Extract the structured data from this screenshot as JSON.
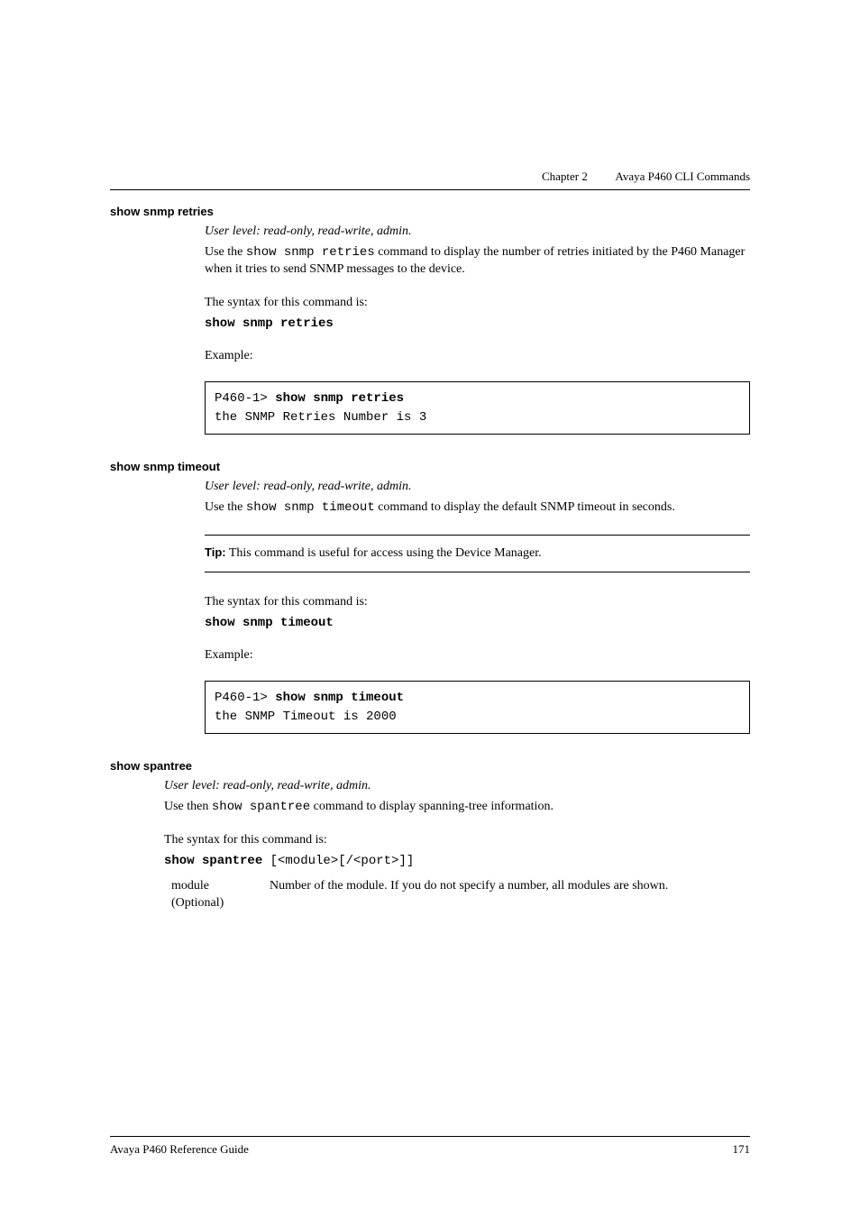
{
  "header": {
    "chapter": "Chapter 2",
    "title": "Avaya P460 CLI Commands"
  },
  "sections": {
    "retries": {
      "heading": "show snmp retries",
      "user_level": "User level: read-only, read-write, admin.",
      "desc_pre": "Use the ",
      "desc_cmd": "show snmp retries",
      "desc_post": " command to display the number of retries initiated by the P460 Manager when it tries to send SNMP messages to the device.",
      "syntax_label": "The syntax for this command is:",
      "syntax_cmd": "show snmp retries",
      "example_label": "Example:",
      "example_prompt": "P460-1> ",
      "example_cmd": "show snmp retries",
      "example_out": "the SNMP Retries Number is 3"
    },
    "timeout": {
      "heading": "show snmp timeout",
      "user_level": "User level: read-only, read-write, admin.",
      "desc_pre": "Use the ",
      "desc_cmd": "show snmp timeout",
      "desc_post": " command to display the default SNMP timeout in seconds.",
      "tip_label": "Tip:",
      "tip_text": "  This command is useful for access using the Device Manager.",
      "syntax_label": "The syntax for this command is:",
      "syntax_cmd": "show snmp timeout",
      "example_label": "Example:",
      "example_prompt": "P460-1> ",
      "example_cmd": "show snmp timeout",
      "example_out": "the SNMP Timeout is 2000"
    },
    "spantree": {
      "heading": "show spantree",
      "user_level": "User level: read-only, read-write, admin.",
      "desc_pre": "Use then ",
      "desc_cmd": "show spantree",
      "desc_post": " command to display spanning-tree information.",
      "syntax_label": "The syntax for this command is:",
      "syntax_cmd": "show spantree",
      "syntax_args": " [<module>[/<port>]]",
      "param1_name": "module",
      "param1_note": "(Optional)",
      "param1_desc": "Number of the module. If you do not specify a number, all modules are shown."
    }
  },
  "footer": {
    "left": "Avaya P460 Reference Guide",
    "right": "171"
  }
}
